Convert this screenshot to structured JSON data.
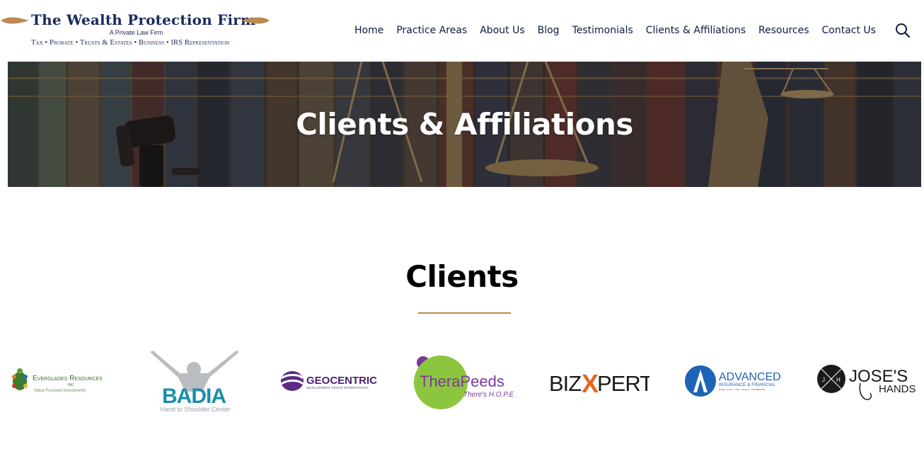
{
  "header": {
    "logo": {
      "title": "The Wealth Protection Firm",
      "subtitle": "A Private Law Firm",
      "tagline": "Tax • Probate • Trusts & Estates • Business • IRS Representation"
    },
    "nav": [
      {
        "label": "Home"
      },
      {
        "label": "Practice Areas"
      },
      {
        "label": "About Us"
      },
      {
        "label": "Blog"
      },
      {
        "label": "Testimonials"
      },
      {
        "label": "Clients & Affiliations"
      },
      {
        "label": "Resources"
      },
      {
        "label": "Contact Us"
      }
    ],
    "search_icon": "search-icon"
  },
  "banner": {
    "title": "Clients & Affiliations"
  },
  "clients": {
    "title": "Clients",
    "accent_color": "#b98a52",
    "logos": [
      {
        "name": "Everglades Resources",
        "line1": "Everglades Resources",
        "line2": "INC",
        "line3": "Value Focused Investments"
      },
      {
        "name": "Badia",
        "line1": "BADIA",
        "line2": "Hand to Shoulder Center"
      },
      {
        "name": "Geocentric",
        "line1": "GEOCENTRIC",
        "line2": "DEVELOPMENT GROUP INTERNATIONAL"
      },
      {
        "name": "TheraPeeds",
        "line1": "TheraPeeds",
        "line2": "There's H.O.P.E"
      },
      {
        "name": "BizXpert",
        "line1": "BIZ",
        "line2": "X",
        "line3": "PERT"
      },
      {
        "name": "Advanced Insurance & Financial",
        "line1": "ADVANCED",
        "line2": "INSURANCE & FINANCIAL",
        "line3": "HOME · AUTO · LIFE · HEALTH · COMMERCIAL"
      },
      {
        "name": "Jose's Hands",
        "line1": "JOSE'S",
        "line2": "HANDS",
        "line3": "J",
        "line4": "H"
      }
    ]
  }
}
